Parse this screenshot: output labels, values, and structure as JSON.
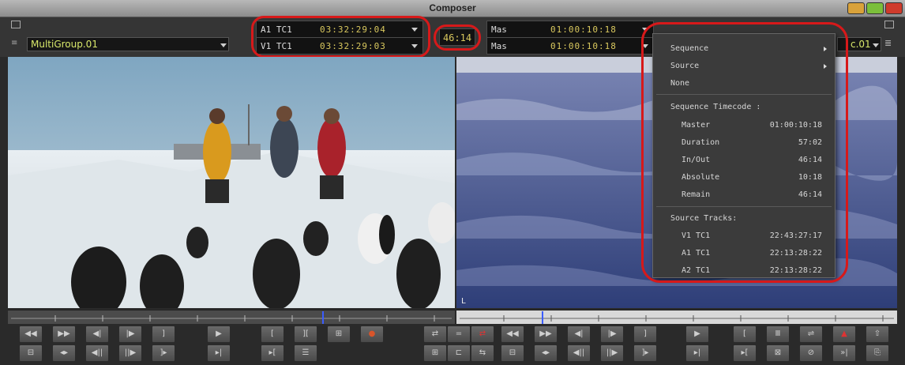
{
  "window": {
    "title": "Composer"
  },
  "source_monitor": {
    "clip_name": "MultiGroup.01",
    "tracks": [
      {
        "label": "A1 TC1",
        "value": "03:32:29:04"
      },
      {
        "label": "V1 TC1",
        "value": "03:32:29:03"
      }
    ]
  },
  "center_counter": "46:14",
  "record_monitor": {
    "tracks": [
      {
        "label": "Mas",
        "value": "01:00:10:18"
      },
      {
        "label": "Mas",
        "value": "01:00:10:18"
      }
    ],
    "clip_name_partial": "c.01"
  },
  "context_menu": {
    "items": [
      {
        "label": "Sequence",
        "submenu": true
      },
      {
        "label": "Source",
        "submenu": true
      },
      {
        "label": "None",
        "submenu": false
      }
    ],
    "sequence_header": "Sequence Timecode :",
    "sequence_timecodes": [
      {
        "label": "Master",
        "value": "01:00:10:18"
      },
      {
        "label": "Duration",
        "value": "57:02"
      },
      {
        "label": "In/Out",
        "value": "46:14"
      },
      {
        "label": "Absolute",
        "value": "10:18"
      },
      {
        "label": "Remain",
        "value": "46:14"
      }
    ],
    "source_header": "Source Tracks:",
    "source_tracks": [
      {
        "label": "V1 TC1",
        "value": "22:43:27:17"
      },
      {
        "label": "A1 TC1",
        "value": "22:13:28:22"
      },
      {
        "label": "A2 TC1",
        "value": "22:13:28:22"
      }
    ]
  },
  "colors": {
    "highlight_ring": "#d7191a",
    "timecode": "#d9c85e",
    "clip_name": "#d8e86a",
    "position_marker": "#3a5cff"
  },
  "transport_left_row1": [
    "◀◀",
    "▶▶",
    "◀|",
    "|▶",
    "]",
    "▶",
    "[",
    "][",
    "⊞",
    "●"
  ],
  "transport_left_row2": [
    "⊟",
    "◂▸",
    "◀||",
    "||▶",
    "]▸",
    "▸|",
    "▸[",
    "☰"
  ],
  "transport_right_row1": [
    "⇄",
    "=",
    "⇄",
    "◀◀",
    "▶▶",
    "◀|",
    "|▶",
    "]",
    "▶",
    "[",
    "Ⅲ",
    "⇌",
    "▲",
    "⇧"
  ],
  "transport_right_row2": [
    "⊞",
    "⊏",
    "⇆",
    "⊟",
    "◂▸",
    "◀||",
    "||▶",
    "]▸",
    "▸|",
    "▸[",
    "⊠",
    "⊘",
    "»|",
    "⎘"
  ]
}
